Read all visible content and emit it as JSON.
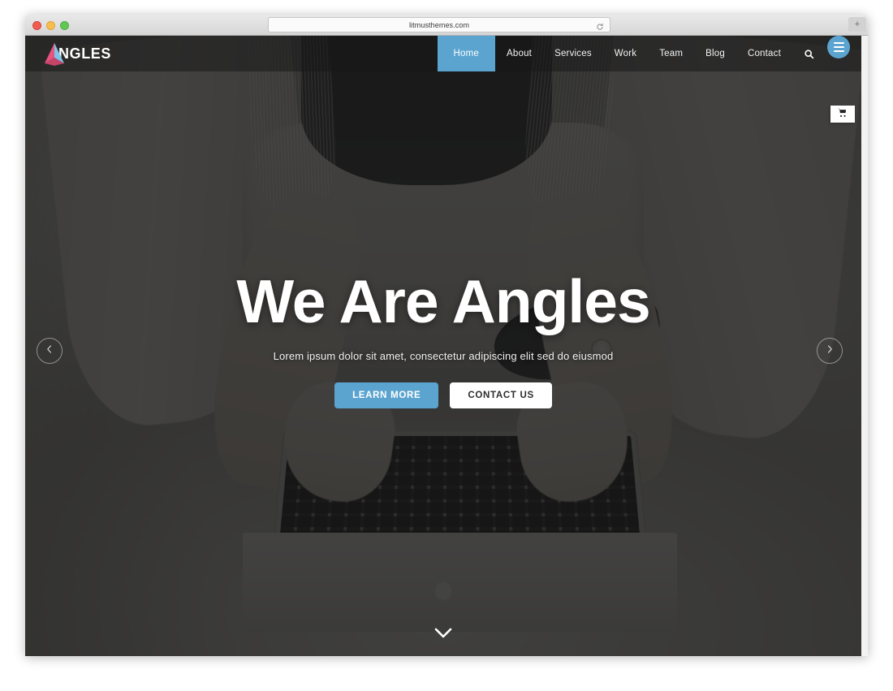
{
  "browser": {
    "url": "litmusthemes.com",
    "reload_icon": "reload-icon",
    "new_tab_label": "+",
    "traffic_lights": [
      "close",
      "minimize",
      "maximize"
    ]
  },
  "site": {
    "brand": {
      "logo_icon": "angles-arrow-logo",
      "name": "NGLES",
      "logo_colors": {
        "pink": "#e8537f",
        "blue": "#7fc3e8"
      }
    },
    "nav": {
      "items": [
        {
          "label": "Home",
          "active": true
        },
        {
          "label": "About",
          "active": false
        },
        {
          "label": "Services",
          "active": false
        },
        {
          "label": "Work",
          "active": false
        },
        {
          "label": "Team",
          "active": false
        },
        {
          "label": "Blog",
          "active": false
        },
        {
          "label": "Contact",
          "active": false
        }
      ],
      "search_icon": "search-icon",
      "menu_toggle_icon": "hamburger-menu-icon",
      "active_color": "#5ba4cf"
    },
    "cart": {
      "icon": "shopping-cart-icon"
    },
    "hero": {
      "title": "We Are Angles",
      "subtitle": "Lorem ipsum dolor sit amet, consectetur adipiscing elit sed do eiusmod",
      "primary_button": "LEARN MORE",
      "secondary_button": "CONTACT US",
      "primary_button_color": "#5ba4cf",
      "secondary_button_color": "#ffffff",
      "background_description": "person sitting cross-legged on white bed typing on laptop",
      "overlay_color": "rgba(28,28,28,0.80)"
    },
    "carousel": {
      "prev_icon": "chevron-left-icon",
      "next_icon": "chevron-right-icon"
    },
    "scroll_indicator_icon": "chevron-down-icon"
  }
}
